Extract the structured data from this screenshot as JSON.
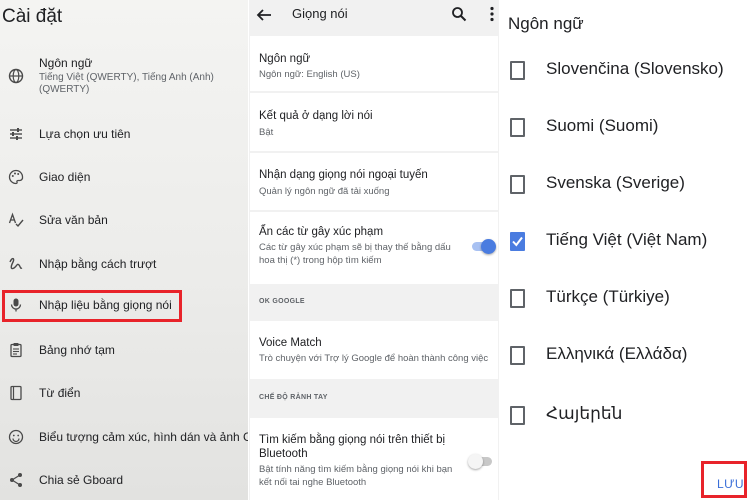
{
  "panel1": {
    "title": "Cài đặt",
    "items": [
      {
        "label": "Ngôn ngữ",
        "sub": "Tiếng Việt (QWERTY), Tiếng Anh (Anh) (QWERTY)",
        "icon": "globe-icon"
      },
      {
        "label": "Lựa chọn ưu tiên",
        "icon": "sliders-icon"
      },
      {
        "label": "Giao diện",
        "icon": "palette-icon"
      },
      {
        "label": "Sửa văn bản",
        "icon": "text-correction-icon"
      },
      {
        "label": "Nhập bằng cách trượt",
        "icon": "gesture-icon"
      },
      {
        "label": "Nhập liệu bằng giọng nói",
        "icon": "microphone-icon"
      },
      {
        "label": "Bảng nhớ tạm",
        "icon": "clipboard-icon"
      },
      {
        "label": "Từ điển",
        "icon": "dictionary-icon"
      },
      {
        "label": "Biểu tượng cảm xúc, hình dán và ảnh GIF",
        "icon": "emoji-icon"
      },
      {
        "label": "Chia sẻ Gboard",
        "icon": "share-icon"
      }
    ]
  },
  "panel2": {
    "title": "Giọng nói",
    "items": {
      "language": {
        "title": "Ngôn ngữ",
        "sub": "Ngôn ngữ: English (US)"
      },
      "results": {
        "title": "Kết quả ở dạng lời nói",
        "sub": "Bật"
      },
      "offline": {
        "title": "Nhận dạng giọng nói ngoại tuyến",
        "sub": "Quản lý ngôn ngữ đã tải xuống"
      },
      "offensive": {
        "title": "Ẩn các từ gây xúc phạm",
        "sub": "Các từ gây xúc phạm sẽ bị thay thế bằng dấu hoa thị (*) trong hộp tìm kiếm",
        "toggle_on": true
      },
      "ok_google_section": "OK GOOGLE",
      "voice_match": {
        "title": "Voice Match",
        "sub": "Trò chuyện với Trợ lý Google để hoàn thành công việc"
      },
      "handsfree_section": "CHẾ ĐỘ RẢNH TAY",
      "bluetooth": {
        "title": "Tìm kiếm bằng giọng nói trên thiết bị Bluetooth",
        "sub": "Bật tính năng tìm kiếm bằng giọng nói khi bạn kết nối tai nghe Bluetooth",
        "toggle_on": false
      }
    }
  },
  "panel3": {
    "title": "Ngôn ngữ",
    "languages": [
      {
        "label": "Slovenčina (Slovensko)",
        "checked": false
      },
      {
        "label": "Suomi (Suomi)",
        "checked": false
      },
      {
        "label": "Svenska (Sverige)",
        "checked": false
      },
      {
        "label": "Tiếng Việt (Việt Nam)",
        "checked": true
      },
      {
        "label": "Türkçe (Türkiye)",
        "checked": false
      },
      {
        "label": "Ελληνικά (Ελλάδα)",
        "checked": false
      },
      {
        "label": "Հայերեն",
        "checked": false
      }
    ],
    "save_label": "LƯU"
  },
  "colors": {
    "highlight": "#e8232a",
    "accent": "#4a7ce0",
    "link": "#3b6fd8"
  }
}
